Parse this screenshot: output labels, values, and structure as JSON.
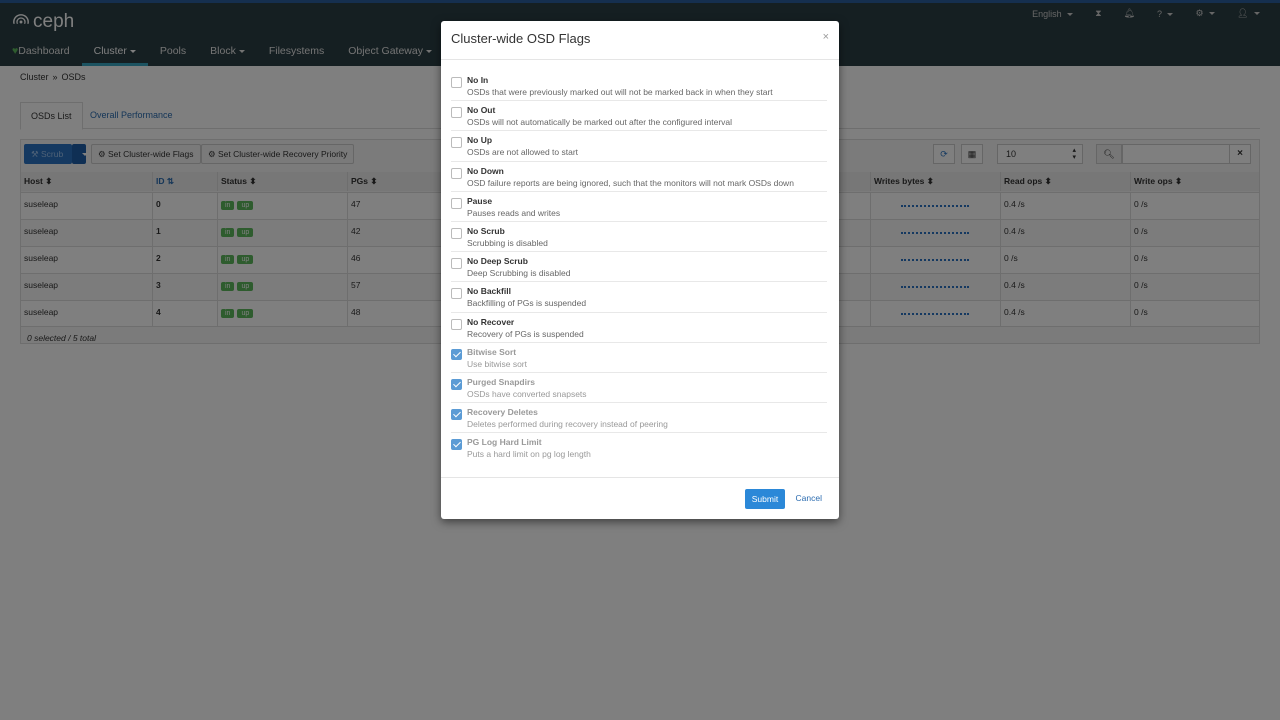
{
  "app": {
    "logo": "ceph"
  },
  "nav": {
    "items": [
      {
        "label": "Dashboard"
      },
      {
        "label": "Cluster",
        "active": true,
        "dropdown": true
      },
      {
        "label": "Pools"
      },
      {
        "label": "Block",
        "dropdown": true
      },
      {
        "label": "Filesystems"
      },
      {
        "label": "Object Gateway",
        "dropdown": true
      }
    ],
    "language": "English"
  },
  "breadcrumb": {
    "parent": "Cluster",
    "separator": "»",
    "current": "OSDs"
  },
  "tabs": [
    {
      "label": "OSDs List"
    },
    {
      "label": "Overall Performance"
    }
  ],
  "toolbar": {
    "scrub_label": "Scrub",
    "flags_label": "Set Cluster-wide Flags",
    "priority_label": "Set Cluster-wide Recovery Priority",
    "rows_per_page": "10",
    "search_value": ""
  },
  "table": {
    "columns": {
      "host": "Host",
      "id": "ID",
      "status": "Status",
      "pgs": "PGs",
      "writes_bytes": "Writes bytes",
      "read_ops": "Read ops",
      "write_ops": "Write ops"
    },
    "rows": [
      {
        "host": "suseleap",
        "id": "0",
        "status_in": "in",
        "status_up": "up",
        "pgs": "47",
        "read_ops": "0.4 /s",
        "write_ops": "0 /s"
      },
      {
        "host": "suseleap",
        "id": "1",
        "status_in": "in",
        "status_up": "up",
        "pgs": "42",
        "read_ops": "0.4 /s",
        "write_ops": "0 /s"
      },
      {
        "host": "suseleap",
        "id": "2",
        "status_in": "in",
        "status_up": "up",
        "pgs": "46",
        "read_ops": "0 /s",
        "write_ops": "0 /s"
      },
      {
        "host": "suseleap",
        "id": "3",
        "status_in": "in",
        "status_up": "up",
        "pgs": "57",
        "read_ops": "0.4 /s",
        "write_ops": "0 /s"
      },
      {
        "host": "suseleap",
        "id": "4",
        "status_in": "in",
        "status_up": "up",
        "pgs": "48",
        "read_ops": "0.4 /s",
        "write_ops": "0 /s"
      }
    ],
    "footer": "0 selected / 5 total"
  },
  "modal": {
    "title": "Cluster-wide OSD Flags",
    "close": "×",
    "flags": [
      {
        "name": "No In",
        "desc": "OSDs that were previously marked out will not be marked back in when they start",
        "checked": false
      },
      {
        "name": "No Out",
        "desc": "OSDs will not automatically be marked out after the configured interval",
        "checked": false
      },
      {
        "name": "No Up",
        "desc": "OSDs are not allowed to start",
        "checked": false
      },
      {
        "name": "No Down",
        "desc": "OSD failure reports are being ignored, such that the monitors will not mark OSDs down",
        "checked": false
      },
      {
        "name": "Pause",
        "desc": "Pauses reads and writes",
        "checked": false
      },
      {
        "name": "No Scrub",
        "desc": "Scrubbing is disabled",
        "checked": false
      },
      {
        "name": "No Deep Scrub",
        "desc": "Deep Scrubbing is disabled",
        "checked": false
      },
      {
        "name": "No Backfill",
        "desc": "Backfilling of PGs is suspended",
        "checked": false
      },
      {
        "name": "No Recover",
        "desc": "Recovery of PGs is suspended",
        "checked": false
      },
      {
        "name": "Bitwise Sort",
        "desc": "Use bitwise sort",
        "checked": true,
        "disabled": true
      },
      {
        "name": "Purged Snapdirs",
        "desc": "OSDs have converted snapsets",
        "checked": true,
        "disabled": true
      },
      {
        "name": "Recovery Deletes",
        "desc": "Deletes performed during recovery instead of peering",
        "checked": true,
        "disabled": true
      },
      {
        "name": "PG Log Hard Limit",
        "desc": "Puts a hard limit on pg log length",
        "checked": true,
        "disabled": true
      }
    ],
    "submit_label": "Submit",
    "cancel_label": "Cancel"
  },
  "colors": {
    "navbar": "#2a3e44",
    "accent": "#2b73c2",
    "badge": "#5cb85c",
    "active_tab_underline": "#39a6c2"
  }
}
